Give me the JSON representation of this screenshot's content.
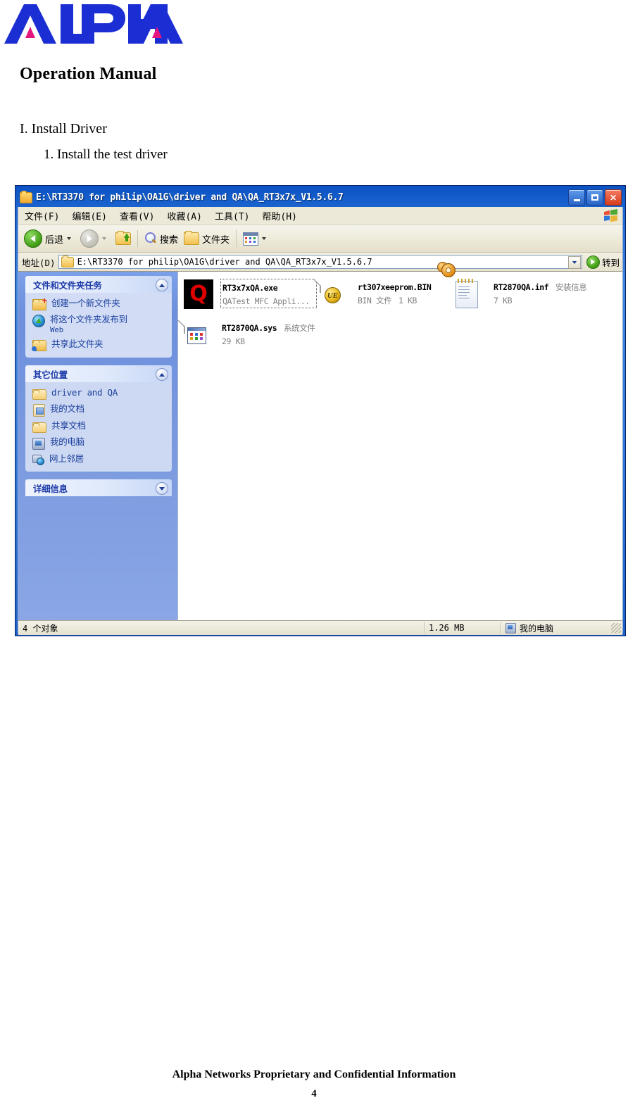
{
  "document": {
    "logo_alt": "ALPHA",
    "logo_blue": "#1a2ed4",
    "logo_pink": "#e3157f",
    "title": "Operation Manual",
    "section_1": "I. Install Driver",
    "section_1_item_1": "1. Install the test driver",
    "footer_text": "Alpha Networks Proprietary and Confidential Information",
    "page_number": "4"
  },
  "window": {
    "title": "E:\\RT3370 for philip\\OA1G\\driver and QA\\QA_RT3x7x_V1.5.6.7",
    "minimize_label": "–",
    "maximize_label": "□",
    "close_label": "✕",
    "titlebar_color": "#2f78da"
  },
  "menu": {
    "items": [
      {
        "label": "文件(F)"
      },
      {
        "label": "编辑(E)"
      },
      {
        "label": "查看(V)"
      },
      {
        "label": "收藏(A)"
      },
      {
        "label": "工具(T)"
      },
      {
        "label": "帮助(H)"
      }
    ]
  },
  "toolbar": {
    "back_label": "后退",
    "search_label": "搜索",
    "folders_label": "文件夹"
  },
  "address": {
    "label": "地址(D)",
    "value": "E:\\RT3370 for philip\\OA1G\\driver and QA\\QA_RT3x7x_V1.5.6.7",
    "go_label": "转到"
  },
  "sidebar": {
    "panels": [
      {
        "title": "文件和文件夹任务",
        "collapsed": false,
        "items": [
          {
            "label": "创建一个新文件夹",
            "sub": ""
          },
          {
            "label": "将这个文件夹发布到",
            "sub": "Web"
          },
          {
            "label": "共享此文件夹",
            "sub": ""
          }
        ]
      },
      {
        "title": "其它位置",
        "collapsed": false,
        "items": [
          {
            "label": "driver and QA",
            "sub": ""
          },
          {
            "label": "我的文档",
            "sub": ""
          },
          {
            "label": "共享文档",
            "sub": ""
          },
          {
            "label": "我的电脑",
            "sub": ""
          },
          {
            "label": "网上邻居",
            "sub": ""
          }
        ]
      },
      {
        "title": "详细信息",
        "collapsed": true,
        "items": []
      }
    ]
  },
  "files": [
    {
      "name": "RT3x7xQA.exe",
      "type": "QATest MFC Appli...",
      "size": "",
      "icon": "exe-q-icon",
      "selected": true
    },
    {
      "name": "rt307xeeprom.BIN",
      "type": "BIN 文件",
      "size": "1 KB",
      "icon": "bin-ue-icon",
      "selected": false
    },
    {
      "name": "RT2870QA.inf",
      "type": "安装信息",
      "size": "7 KB",
      "icon": "inf-setup-icon",
      "selected": false
    },
    {
      "name": "RT2870QA.sys",
      "type": "系统文件",
      "size": "29 KB",
      "icon": "sys-file-icon",
      "selected": false
    }
  ],
  "statusbar": {
    "objects": "4 个对象",
    "size": "1.26 MB",
    "location": "我的电脑"
  }
}
